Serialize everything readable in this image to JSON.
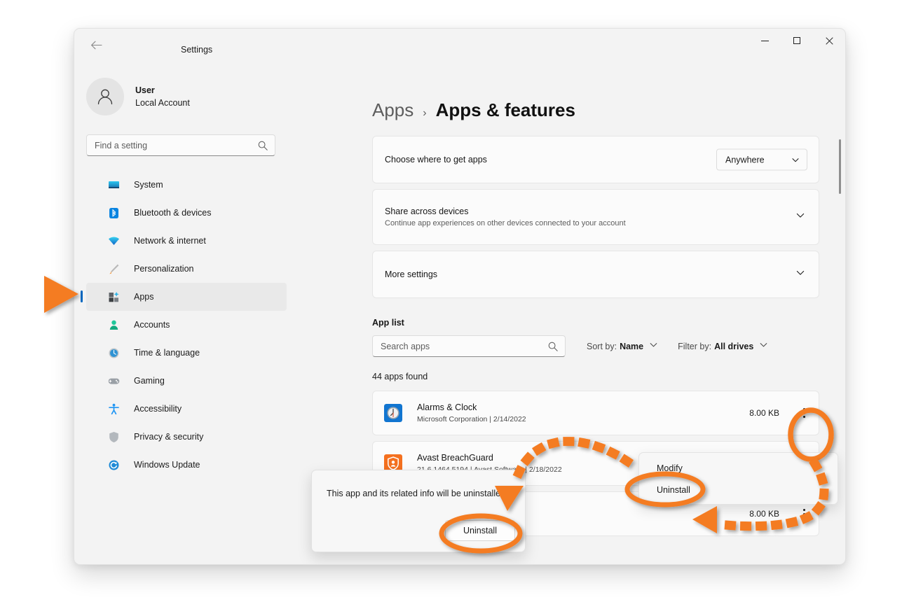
{
  "window": {
    "title": "Settings",
    "back_icon": "back-arrow-icon",
    "minimize_label": "Minimize",
    "maximize_label": "Maximize",
    "close_label": "Close"
  },
  "account": {
    "name": "User",
    "type": "Local Account",
    "avatar_icon": "person-avatar-icon"
  },
  "search": {
    "placeholder": "Find a setting",
    "icon": "search-icon"
  },
  "sidebar": {
    "items": [
      {
        "label": "System",
        "icon": "monitor-icon",
        "active": false
      },
      {
        "label": "Bluetooth & devices",
        "icon": "bluetooth-icon",
        "active": false
      },
      {
        "label": "Network & internet",
        "icon": "wifi-icon",
        "active": false
      },
      {
        "label": "Personalization",
        "icon": "paintbrush-icon",
        "active": false
      },
      {
        "label": "Apps",
        "icon": "apps-grid-icon",
        "active": true
      },
      {
        "label": "Accounts",
        "icon": "person-icon",
        "active": false
      },
      {
        "label": "Time & language",
        "icon": "clock-globe-icon",
        "active": false
      },
      {
        "label": "Gaming",
        "icon": "gamepad-icon",
        "active": false
      },
      {
        "label": "Accessibility",
        "icon": "accessibility-person-icon",
        "active": false
      },
      {
        "label": "Privacy & security",
        "icon": "shield-icon",
        "active": false
      },
      {
        "label": "Windows Update",
        "icon": "update-refresh-icon",
        "active": false
      }
    ]
  },
  "breadcrumb": {
    "parent": "Apps",
    "separator": "›",
    "current": "Apps & features"
  },
  "settings_cards": [
    {
      "title": "Choose where to get apps",
      "subtitle": "",
      "control": "dropdown",
      "value": "Anywhere"
    },
    {
      "title": "Share across devices",
      "subtitle": "Continue app experiences on other devices connected to your account",
      "control": "chevron",
      "value": ""
    },
    {
      "title": "More settings",
      "subtitle": "",
      "control": "chevron",
      "value": ""
    }
  ],
  "app_list": {
    "heading": "App list",
    "search_placeholder": "Search apps",
    "search_icon": "search-icon",
    "sort_label": "Sort by:",
    "sort_value": "Name",
    "filter_label": "Filter by:",
    "filter_value": "All drives",
    "count_text": "44 apps found",
    "rows": [
      {
        "name": "Alarms & Clock",
        "detail": "Microsoft Corporation  |  2/14/2022",
        "size": "8.00 KB",
        "icon": "alarms-clock-app-icon",
        "menu_icon": "kebab-menu-icon"
      },
      {
        "name": "Avast BreachGuard",
        "detail": "21.6.1464.5194  |  Avast Software  |  2/18/2022",
        "size": "",
        "icon": "avast-breachguard-app-icon",
        "menu_icon": "kebab-menu-icon"
      },
      {
        "name": "",
        "detail": "",
        "size": "8.00 KB",
        "icon": "",
        "menu_icon": "kebab-menu-icon"
      }
    ]
  },
  "context_menu": {
    "items": [
      {
        "label": "Modify"
      },
      {
        "label": "Uninstall"
      }
    ]
  },
  "confirm_dialog": {
    "message": "This app and its related info will be uninstalled.",
    "button_label": "Uninstall"
  },
  "annotations": {
    "accent_color": "#F47B20",
    "shapes": [
      "arrow-pointing-apps-sidebar",
      "circle-kebab-menu",
      "circle-context-uninstall",
      "circle-dialog-uninstall",
      "dashed-arrow-kebab-to-uninstall",
      "dashed-arrow-uninstall-to-dialog"
    ]
  },
  "colors": {
    "accent_blue": "#0067c0",
    "window_bg": "#f3f3f3",
    "card_bg": "#fbfbfb",
    "annotation_orange": "#F47B20"
  }
}
